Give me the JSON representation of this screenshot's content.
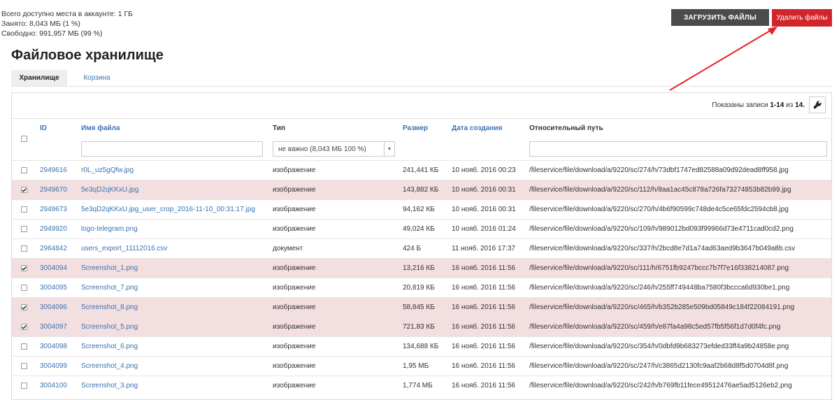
{
  "quota": {
    "total": "Всего доступно места в аккаунте: 1 ГБ",
    "used": "Занято: 8,043 МБ (1 %)",
    "free": "Свободно: 991,957 МБ (99 %)"
  },
  "buttons": {
    "upload": "ЗАГРУЗИТЬ ФАЙЛЫ",
    "delete": "Удалить файлы"
  },
  "page_title": "Файловое хранилище",
  "tabs": [
    {
      "label": "Хранилище"
    },
    {
      "label": "Корзина"
    }
  ],
  "toolbar": {
    "records_prefix": "Показаны записи ",
    "records_range": "1-14",
    "records_mid": " из ",
    "records_total": "14",
    "records_suffix": "."
  },
  "columns": {
    "id": "ID",
    "name": "Имя файла",
    "type": "Тип",
    "size": "Размер",
    "date": "Дата создания",
    "path": "Относительный путь"
  },
  "filters": {
    "type_value": "не важно (8,043 МБ 100 %)"
  },
  "colors": {
    "accent_link": "#3a73b3",
    "delete_button": "#d0262b",
    "upload_button": "#4b4b4b",
    "selected_row": "#f3dfe0",
    "arrow": "#e8202a"
  },
  "rows": [
    {
      "checked": false,
      "id": "2949616",
      "name": "r0L_uz5gQfw.jpg",
      "type": "изображение",
      "size": "241,441 КБ",
      "date": "10 нояб. 2016 00:23",
      "path": "/fileservice/file/download/a/9220/sc/274/h/73dbf1747ed82588a09d92dead8ff958.jpg"
    },
    {
      "checked": true,
      "id": "2949670",
      "name": "5e3qD2qKKxU.jpg",
      "type": "изображение",
      "size": "143,882 КБ",
      "date": "10 нояб. 2016 00:31",
      "path": "/fileservice/file/download/a/9220/sc/112/h/8aa1ac45c878a726fa73274853b82b99.jpg"
    },
    {
      "checked": false,
      "id": "2949673",
      "name": "5e3qD2qKKxU.jpg_user_crop_2016-11-10_00:31:17.jpg",
      "type": "изображение",
      "size": "94,162 КБ",
      "date": "10 нояб. 2016 00:31",
      "path": "/fileservice/file/download/a/9220/sc/270/h/4b6f90599c748de4c5ce65fdc2594cb8.jpg"
    },
    {
      "checked": false,
      "id": "2949920",
      "name": "logo-telegram.png",
      "type": "изображение",
      "size": "49,024 КБ",
      "date": "10 нояб. 2016 01:24",
      "path": "/fileservice/file/download/a/9220/sc/109/h/989012bd093f99966d73e4711cad0cd2.png"
    },
    {
      "checked": false,
      "id": "2964842",
      "name": "users_export_11112016.csv",
      "type": "документ",
      "size": "424 Б",
      "date": "11 нояб. 2016 17:37",
      "path": "/fileservice/file/download/a/9220/sc/337/h/2bcd8e7d1a74ad63aed9b3647b049a8b.csv"
    },
    {
      "checked": true,
      "id": "3004094",
      "name": "Screenshot_1.png",
      "type": "изображение",
      "size": "13,216 КБ",
      "date": "16 нояб. 2016 11:56",
      "path": "/fileservice/file/download/a/9220/sc/111/h/6751fb9247bccc7b7f7e16f338214087.png"
    },
    {
      "checked": false,
      "id": "3004095",
      "name": "Screenshot_7.png",
      "type": "изображение",
      "size": "20,819 КБ",
      "date": "16 нояб. 2016 11:56",
      "path": "/fileservice/file/download/a/9220/sc/246/h/255ff749448ba7580f3bccca6d930be1.png"
    },
    {
      "checked": true,
      "id": "3004096",
      "name": "Screenshot_8.png",
      "type": "изображение",
      "size": "58,845 КБ",
      "date": "16 нояб. 2016 11:56",
      "path": "/fileservice/file/download/a/9220/sc/465/h/b352b285e509bd05849c184f22084191.png"
    },
    {
      "checked": true,
      "id": "3004097",
      "name": "Screenshot_5.png",
      "type": "изображение",
      "size": "721,83 КБ",
      "date": "16 нояб. 2016 11:56",
      "path": "/fileservice/file/download/a/9220/sc/459/h/e87fa4a98c5ed57fb5f56f1d7d0f4fc.png"
    },
    {
      "checked": false,
      "id": "3004098",
      "name": "Screenshot_6.png",
      "type": "изображение",
      "size": "134,688 КБ",
      "date": "16 нояб. 2016 11:56",
      "path": "/fileservice/file/download/a/9220/sc/354/h/0dbfd9b683273efded33ff4a9b24858e.png"
    },
    {
      "checked": false,
      "id": "3004099",
      "name": "Screenshot_4.png",
      "type": "изображение",
      "size": "1,95 МБ",
      "date": "16 нояб. 2016 11:56",
      "path": "/fileservice/file/download/a/9220/sc/247/h/c3865d2130fc9aaf2b68d8f5d0704d8f.png"
    },
    {
      "checked": false,
      "id": "3004100",
      "name": "Screenshot_3.png",
      "type": "изображение",
      "size": "1,774 МБ",
      "date": "16 нояб. 2016 11:56",
      "path": "/fileservice/file/download/a/9220/sc/242/h/b769fb11fece49512476ae5ad5126eb2.png"
    }
  ]
}
